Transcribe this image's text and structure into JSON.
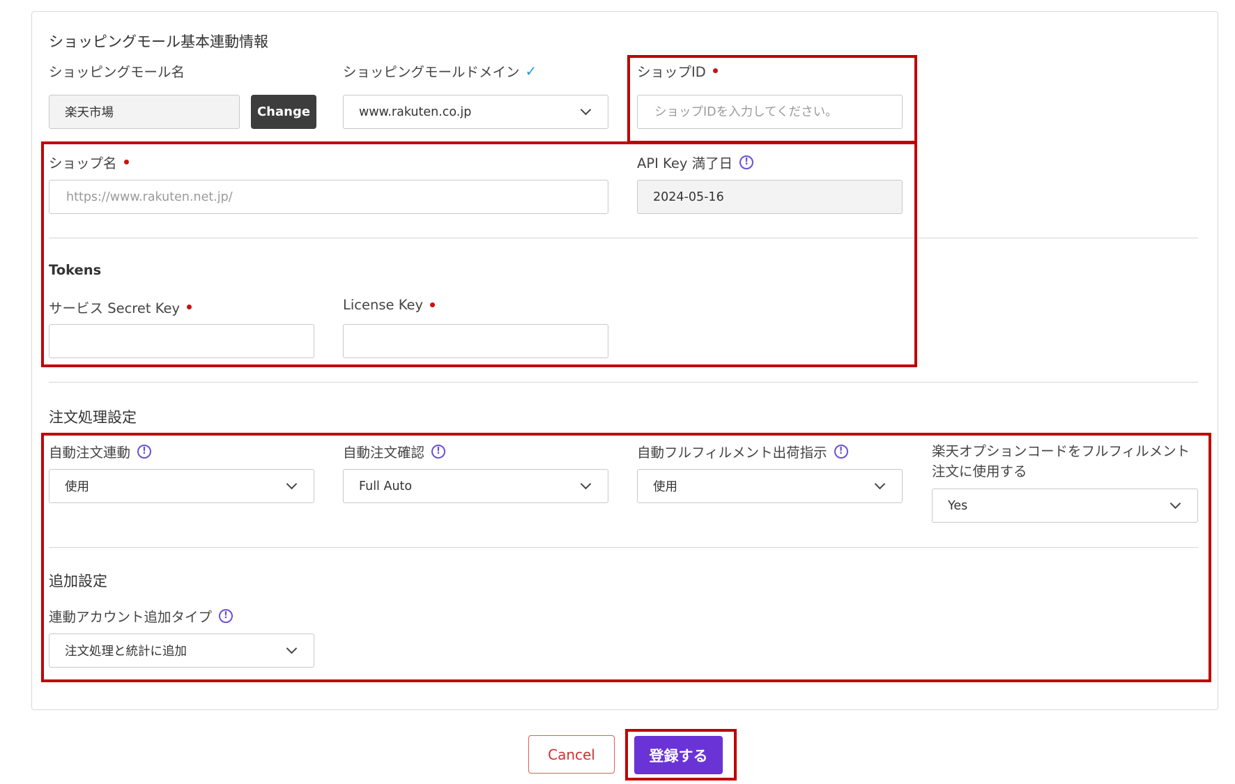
{
  "section_basic": {
    "title": "ショッピングモール基本連動情報",
    "mall_name_label": "ショッピングモール名",
    "mall_name_value": "楽天市場",
    "change_button": "Change",
    "domain_label": "ショッピングモールドメイン",
    "domain_value": "www.rakuten.co.jp",
    "shop_id_label": "ショップID",
    "shop_id_placeholder": "ショップIDを入力してください。",
    "shop_name_label": "ショップ名",
    "shop_name_placeholder": "https://www.rakuten.net.jp/",
    "api_key_label": "API Key 満了日",
    "api_key_value": "2024-05-16"
  },
  "tokens": {
    "title": "Tokens",
    "secret_key_label": "サービス Secret Key",
    "license_key_label": "License Key"
  },
  "order": {
    "title": "注文処理設定",
    "auto_link_label": "自動注文連動",
    "auto_link_value": "使用",
    "auto_confirm_label": "自動注文確認",
    "auto_confirm_value": "Full Auto",
    "auto_fulfill_label": "自動フルフィルメント出荷指示",
    "auto_fulfill_value": "使用",
    "option_code_label_line1": "楽天オプションコードをフルフィルメント",
    "option_code_label_line2": "注文に使用する",
    "option_code_value": "Yes"
  },
  "additional": {
    "title": "追加設定",
    "account_type_label": "連動アカウント追加タイプ",
    "account_type_value": "注文処理と統計に追加"
  },
  "actions": {
    "cancel": "Cancel",
    "submit": "登録する"
  },
  "colors": {
    "primary": "#6a33d6",
    "highlight_border": "#c00000",
    "required_dot": "#cc1111",
    "info_icon": "#6b4fd8",
    "check_icon": "#1e9ad6"
  }
}
